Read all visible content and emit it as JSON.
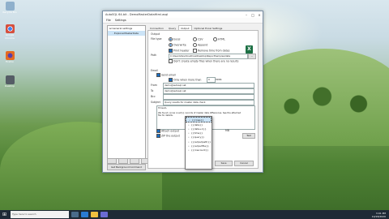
{
  "desktop_icons": [
    {
      "label": "Recycle Bin",
      "color": "#8fb0cc"
    },
    {
      "label": "Google Chrome",
      "color": "#d64f3e"
    },
    {
      "label": "Firefox",
      "color": "#e66b21"
    },
    {
      "label": "Desktop",
      "color": "#555d66"
    }
  ],
  "window": {
    "title": "AutoSQL 64-bit - DemoMasterDataHtml.asql",
    "menu": [
      "File",
      "Settings"
    ],
    "tree": [
      "General settings",
      "ExplorerMasterData"
    ],
    "get_background_label": "Get Background Command"
  },
  "tabs": [
    "Connection",
    "Query",
    "Output",
    "Optional Excel Settings"
  ],
  "output": {
    "section_label": "Output",
    "file_type_label": "File type",
    "file_types": [
      "Excel",
      "CSV",
      "HTML"
    ],
    "mode_options": [
      "Overwrite",
      "Append"
    ],
    "print_header_label": "Print header",
    "remove_time_label": "Remove time from dates",
    "path_label": "Path",
    "path_value": "C:\\Users\\Dev\\OneDrive\\Desktop\\ReportSamples\\data",
    "browse_label": "...",
    "dont_create_empty_label": "Don't create empty files when there are no results"
  },
  "email": {
    "section_label": "Email",
    "send_label": "Send email",
    "only_when_more_than_label": "Only when more than",
    "threshold": "0",
    "rows_label": "rows",
    "from_label": "From",
    "from_value": "demo@autosql.net",
    "to_label": "To",
    "to_value": "demo@autosql.net",
    "bcc_label": "Bcc",
    "bcc_value": "",
    "subject_label": "Subject",
    "subject_value": "Query results for master data check",
    "body_label": "Body",
    "body_lines": [
      "Hi team,",
      "",
      "We found {{row count}} records of master data differences. See the attached",
      "file for details."
    ],
    "attach_label": "Attach output",
    "zip_label": "ZIP the output",
    "test_label": "Test",
    "mb_label": "MB"
  },
  "dropdown": {
    "items": [
      "{{rows}}",
      "{{date}}",
      "{{date+1}}",
      "{{time}}",
      "{{query}}",
      "{{outputpath}}",
      "{{outputfile}}",
      "{{rowcount}}"
    ]
  },
  "footer": {
    "save_label": "Save",
    "cancel_label": "Cancel"
  },
  "taskbar": {
    "search_placeholder": "Type here to search",
    "time": "3:01 PM",
    "date": "10/18/2020"
  }
}
